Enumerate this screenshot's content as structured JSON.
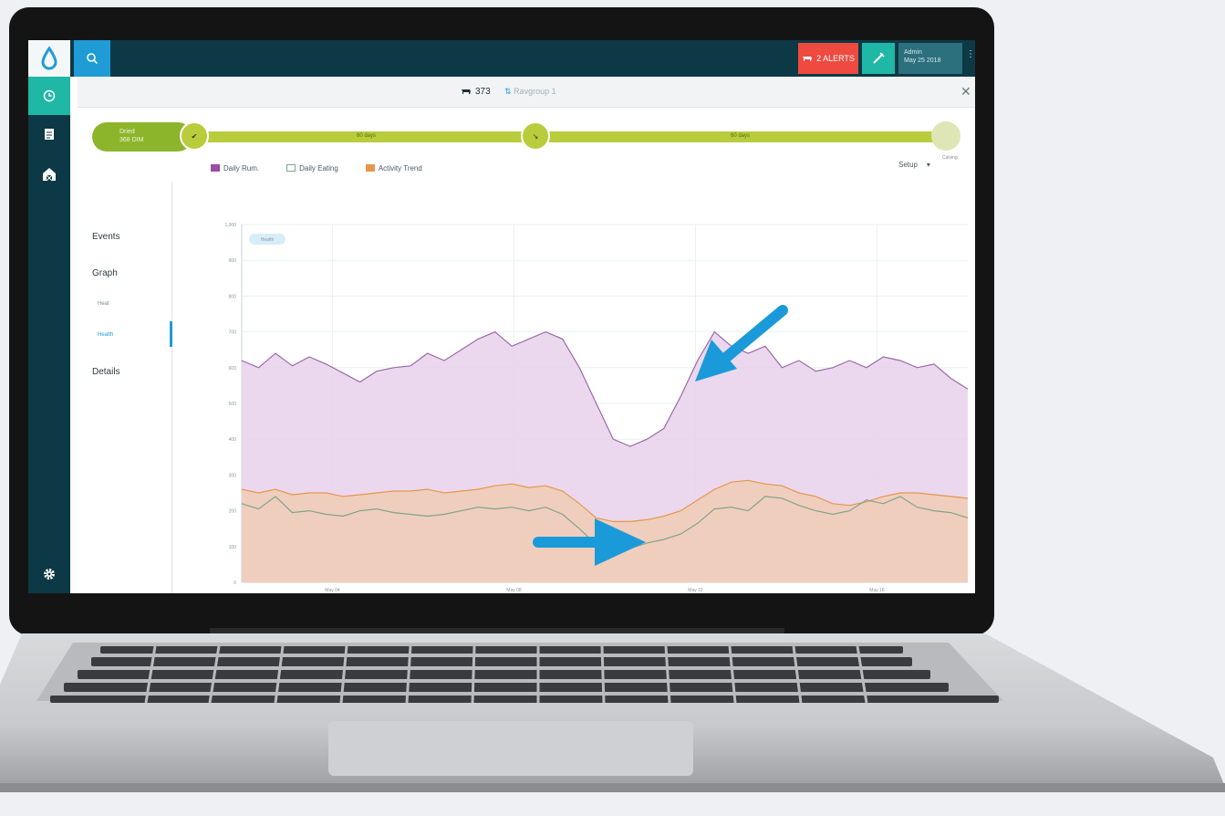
{
  "topbar": {
    "alerts_label": "2 ALERTS",
    "user_name": "Admin",
    "user_date": "May 25 2018"
  },
  "panel": {
    "cow_id": "373",
    "group": "Ravgroup 1"
  },
  "timeline": {
    "start_line1": "Dried",
    "start_line2": "368 DIM",
    "segment_1": "60 days",
    "segment_2": "60 days",
    "end_label": "Calving"
  },
  "legend": {
    "items": [
      "Daily Rum.",
      "Daily Eating",
      "Activity Trend"
    ],
    "setup_label": "Setup"
  },
  "nav": {
    "events": "Events",
    "graph": "Graph",
    "graph_sub_1": "Heat",
    "graph_sub_2": "Health",
    "details": "Details"
  },
  "chart_data": {
    "type": "area",
    "badge": "Health",
    "ylim": [
      0,
      1000
    ],
    "y_ticks": [
      "0",
      "100",
      "200",
      "300",
      "400",
      "500",
      "600",
      "700",
      "800",
      "900",
      "1,000"
    ],
    "x_ticks": [
      "May 04",
      "May 08",
      "May 12",
      "May 16"
    ],
    "series": [
      {
        "color": "#e7d1ec",
        "stroke": "#9b6aa7",
        "values": [
          620,
          600,
          640,
          605,
          630,
          610,
          585,
          560,
          590,
          600,
          605,
          640,
          620,
          650,
          680,
          700,
          660,
          680,
          700,
          680,
          600,
          500,
          400,
          380,
          400,
          430,
          520,
          620,
          700,
          660,
          640,
          660,
          600,
          620,
          590,
          600,
          620,
          600,
          630,
          620,
          600,
          610,
          570,
          540
        ]
      },
      {
        "color": "#f1cdb4",
        "stroke": "#e5964c",
        "values": [
          260,
          250,
          260,
          245,
          250,
          250,
          240,
          245,
          250,
          255,
          255,
          260,
          250,
          255,
          260,
          270,
          275,
          265,
          270,
          255,
          220,
          180,
          170,
          170,
          175,
          185,
          200,
          230,
          260,
          280,
          285,
          275,
          270,
          250,
          240,
          220,
          215,
          225,
          240,
          250,
          250,
          245,
          240,
          235
        ]
      },
      {
        "color": "none",
        "stroke": "#7ea48a",
        "values": [
          220,
          205,
          240,
          195,
          200,
          190,
          185,
          200,
          205,
          195,
          190,
          185,
          190,
          200,
          210,
          205,
          210,
          200,
          210,
          190,
          150,
          105,
          100,
          95,
          110,
          120,
          135,
          165,
          205,
          210,
          200,
          240,
          235,
          215,
          200,
          190,
          200,
          230,
          220,
          240,
          210,
          200,
          195,
          180
        ]
      }
    ]
  }
}
